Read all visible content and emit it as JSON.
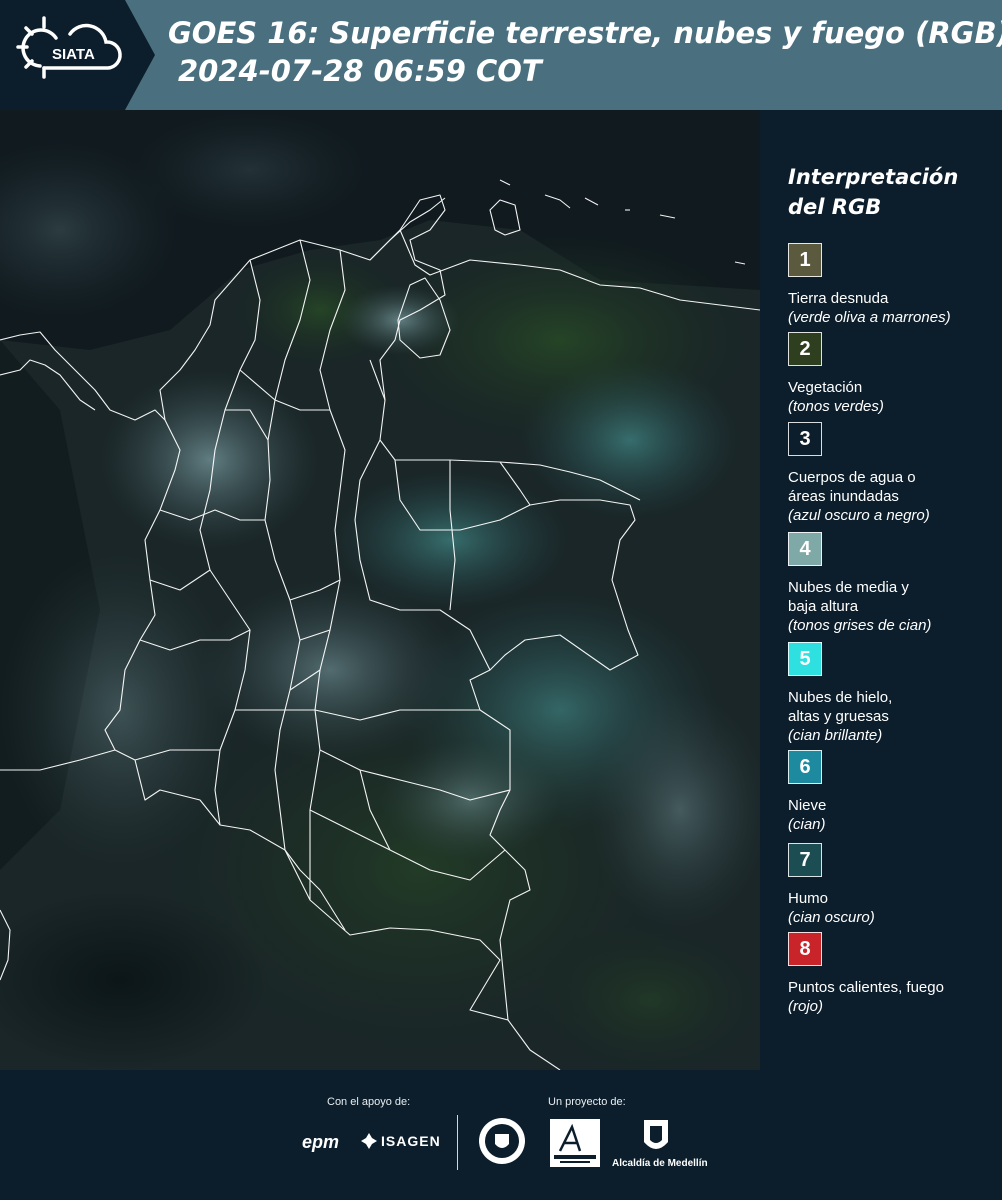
{
  "header": {
    "logo_text": "SIATA",
    "title_line1": "GOES 16: Superficie terrestre, nubes y fuego (RGB)",
    "title_line2": "2024-07-28 06:59 COT"
  },
  "legend": {
    "title_line1": "Interpretación",
    "title_line2": "del RGB",
    "items": [
      {
        "number": "1",
        "label": "Tierra desnuda",
        "sub": "(verde oliva a marrones)",
        "color": "#5c5a3e"
      },
      {
        "number": "2",
        "label": "Vegetación",
        "sub": "(tonos verdes)",
        "color": "#2e3f20"
      },
      {
        "number": "3",
        "label": "Cuerpos de agua o\náreas inundadas",
        "sub": "(azul oscuro a negro)",
        "color": "#0c1e2b"
      },
      {
        "number": "4",
        "label": "Nubes de media y\nbaja altura",
        "sub": "(tonos grises de cian)",
        "color": "#7fa9a7"
      },
      {
        "number": "5",
        "label": "Nubes de hielo,\naltas y gruesas",
        "sub": "(cian brillante)",
        "color": "#2ee0e0"
      },
      {
        "number": "6",
        "label": "Nieve",
        "sub": "(cian)",
        "color": "#1e8aa0"
      },
      {
        "number": "7",
        "label": "Humo",
        "sub": "(cian oscuro)",
        "color": "#1b4d52"
      },
      {
        "number": "8",
        "label": "Puntos calientes, fuego",
        "sub": "(rojo)",
        "color": "#c8242a"
      }
    ]
  },
  "footer": {
    "support_label": "Con el apoyo de:",
    "project_label": "Un proyecto de:",
    "sponsor_epm": "epm",
    "sponsor_isagen": "ISAGEN",
    "alcaldia_label": "Alcaldía de Medellín"
  },
  "colors": {
    "header_bg": "#4a7080",
    "panel_bg": "#0c1e2b",
    "border_lines": "#ffffff"
  }
}
